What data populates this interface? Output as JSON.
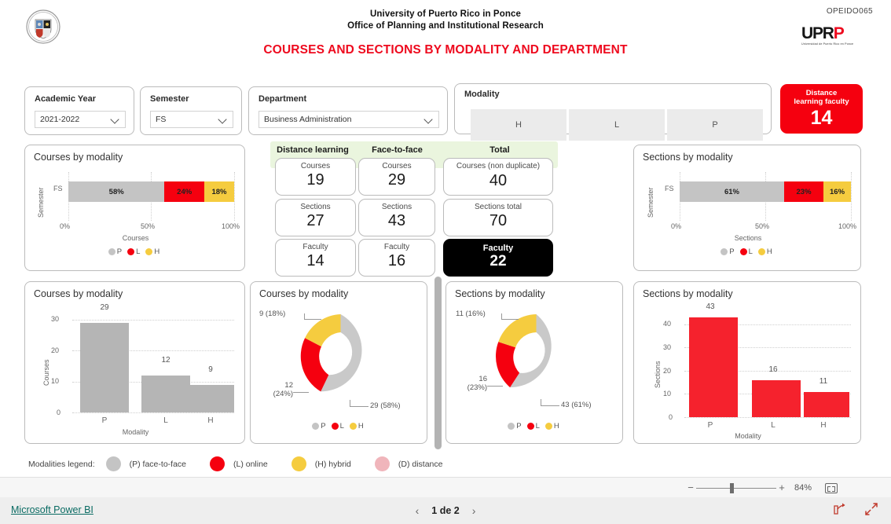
{
  "header": {
    "org_line1": "University of Puerto Rico in Ponce",
    "org_line2": "Office of Planning and Institutional Research",
    "report_title": "COURSES AND SECTIONS BY MODALITY AND DEPARTMENT",
    "opeid": "OPEIDO065",
    "logo_word_1": "UPR",
    "logo_word_2": "P",
    "logo_sub": "Universidad de Puerto Rico en Ponce"
  },
  "slicers": {
    "academic_year": {
      "label": "Academic Year",
      "value": "2021-2022"
    },
    "semester": {
      "label": "Semester",
      "value": "FS"
    },
    "department": {
      "label": "Department",
      "value": "Business Administration"
    },
    "modality": {
      "label": "Modality",
      "options": [
        "H",
        "L",
        "P"
      ]
    }
  },
  "kpi_distance_faculty": {
    "label_line1": "Distance",
    "label_line2": "learning faculty",
    "value": "14",
    "color": "#f5000f"
  },
  "kpi_panel": {
    "columns": [
      "Distance learning",
      "Face-to-face",
      "Total"
    ],
    "distance_learning": [
      {
        "label": "Courses",
        "value": "19"
      },
      {
        "label": "Sections",
        "value": "27"
      },
      {
        "label": "Faculty",
        "value": "14"
      }
    ],
    "face_to_face": [
      {
        "label": "Courses",
        "value": "29"
      },
      {
        "label": "Sections",
        "value": "43"
      },
      {
        "label": "Faculty",
        "value": "16"
      }
    ],
    "total": [
      {
        "label": "Courses (non duplicate)",
        "value": "40"
      },
      {
        "label": "Sections total",
        "value": "70"
      },
      {
        "label": "Faculty",
        "value": "22"
      }
    ]
  },
  "modalities_legend": {
    "caption": "Modalities legend:",
    "items": [
      {
        "label": "(P) face-to-face",
        "color": "#c4c4c4"
      },
      {
        "label": "(L) online",
        "color": "#f5000f"
      },
      {
        "label": "(H) hybrid",
        "color": "#f5cc3f"
      },
      {
        "label": "(D) distance",
        "color": "#f0b5bb"
      }
    ]
  },
  "statusbar": {
    "zoom": "84%",
    "minus": "−",
    "plus": "+"
  },
  "footer": {
    "powerbi": "Microsoft Power BI",
    "page": "1 de 2",
    "prev": "‹",
    "next": "›"
  },
  "chart_data": [
    {
      "id": "courses_stacked",
      "type": "bar",
      "title": "Courses by modality",
      "orientation": "horizontal-stacked-100",
      "ylabel": "Semester",
      "xlabel": "Courses",
      "categories": [
        "FS"
      ],
      "ticks": [
        "0%",
        "50%",
        "100%"
      ],
      "series": [
        {
          "name": "P",
          "color": "#c4c4c4",
          "values": [
            58
          ],
          "label": "58%"
        },
        {
          "name": "L",
          "color": "#f5000f",
          "values": [
            24
          ],
          "label": "24%"
        },
        {
          "name": "H",
          "color": "#f5cc3f",
          "values": [
            18
          ],
          "label": "18%"
        }
      ],
      "legend": [
        "P",
        "L",
        "H"
      ]
    },
    {
      "id": "sections_stacked",
      "type": "bar",
      "title": "Sections by modality",
      "orientation": "horizontal-stacked-100",
      "ylabel": "Semester",
      "xlabel": "Sections",
      "categories": [
        "FS"
      ],
      "ticks": [
        "0%",
        "50%",
        "100%"
      ],
      "series": [
        {
          "name": "P",
          "color": "#c4c4c4",
          "values": [
            61
          ],
          "label": "61%"
        },
        {
          "name": "L",
          "color": "#f5000f",
          "values": [
            23
          ],
          "label": "23%"
        },
        {
          "name": "H",
          "color": "#f5cc3f",
          "values": [
            16
          ],
          "label": "16%"
        }
      ],
      "legend": [
        "P",
        "L",
        "H"
      ]
    },
    {
      "id": "courses_column",
      "type": "bar",
      "title": "Courses by modality",
      "ylabel": "Courses",
      "xlabel": "Modality",
      "categories": [
        "P",
        "L",
        "H"
      ],
      "values": [
        29,
        12,
        9
      ],
      "value_labels": [
        "29",
        "12",
        "9"
      ],
      "yticks": [
        "0",
        "10",
        "20",
        "30"
      ],
      "ylim": [
        0,
        33
      ],
      "bar_color": "#b5b5b5"
    },
    {
      "id": "courses_donut",
      "type": "pie",
      "title": "Courses by modality",
      "labels": [
        "P",
        "L",
        "H"
      ],
      "values": [
        29,
        12,
        9
      ],
      "percents": [
        58,
        24,
        18
      ],
      "colors": [
        "#c9c9c9",
        "#f5000f",
        "#f5cc3f"
      ],
      "callouts": [
        "29 (58%)",
        "12\n(24%)",
        "9 (18%)"
      ],
      "legend": [
        "P",
        "L",
        "H"
      ]
    },
    {
      "id": "sections_donut",
      "type": "pie",
      "title": "Sections by modality",
      "labels": [
        "P",
        "L",
        "H"
      ],
      "values": [
        43,
        16,
        11
      ],
      "percents": [
        61,
        23,
        16
      ],
      "colors": [
        "#c9c9c9",
        "#f5000f",
        "#f5cc3f"
      ],
      "callouts": [
        "43 (61%)",
        "16\n(23%)",
        "11 (16%)"
      ],
      "legend": [
        "P",
        "L",
        "H"
      ]
    },
    {
      "id": "sections_column",
      "type": "bar",
      "title": "Sections by modality",
      "ylabel": "Sections",
      "xlabel": "Modality",
      "categories": [
        "P",
        "L",
        "H"
      ],
      "values": [
        43,
        16,
        11
      ],
      "value_labels": [
        "43",
        "16",
        "11"
      ],
      "yticks": [
        "0",
        "10",
        "20",
        "30",
        "40"
      ],
      "ylim": [
        0,
        46
      ],
      "bar_color": "#f5222d"
    }
  ]
}
